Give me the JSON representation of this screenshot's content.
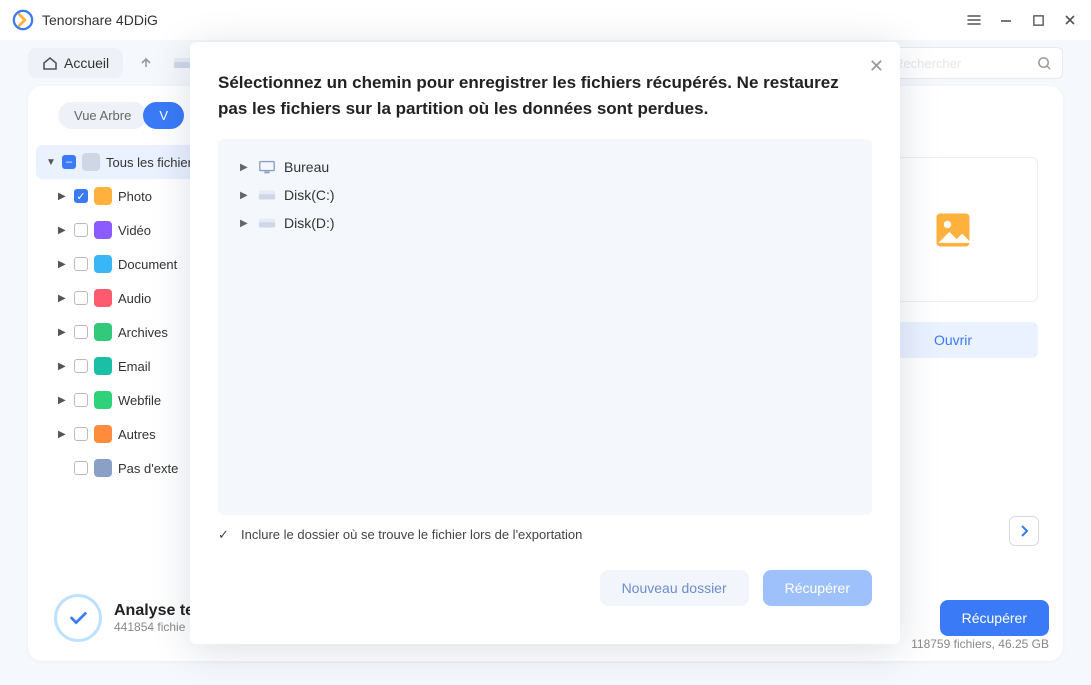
{
  "app": {
    "title": "Tenorshare 4DDiG"
  },
  "toolbar": {
    "home": "Accueil",
    "search_placeholder": "Rechercher"
  },
  "tabs": {
    "tree": "Vue Arbre",
    "active_prefix": "V"
  },
  "sidebar": {
    "root": "Tous les fichiers",
    "items": [
      {
        "label": "Photo",
        "color": "fi-orange",
        "checked": true
      },
      {
        "label": "Vidéo",
        "color": "fi-purple",
        "checked": false
      },
      {
        "label": "Document",
        "color": "fi-cyan",
        "checked": false
      },
      {
        "label": "Audio",
        "color": "fi-red",
        "checked": false
      },
      {
        "label": "Archives",
        "color": "fi-green",
        "checked": false
      },
      {
        "label": "Email",
        "color": "fi-teal",
        "checked": false
      },
      {
        "label": "Webfile",
        "color": "fi-green2",
        "checked": false
      },
      {
        "label": "Autres",
        "color": "fi-orange2",
        "checked": false
      },
      {
        "label": "Pas d'exte",
        "color": "fi-gray",
        "checked": false,
        "nocaret": true
      }
    ]
  },
  "right": {
    "open": "Ouvrir"
  },
  "footer": {
    "title": "Analyse te",
    "subtitle": "441854 fichie",
    "recover": "Récupérer",
    "stats": "118759 fichiers, 46.25 GB"
  },
  "modal": {
    "heading": "Sélectionnez un chemin pour enregistrer les fichiers récupérés. Ne restaurez pas les fichiers sur la partition où les données sont perdues.",
    "destinations": [
      {
        "label": "Bureau",
        "type": "desktop"
      },
      {
        "label": "Disk(C:)",
        "type": "disk"
      },
      {
        "label": "Disk(D:)",
        "type": "disk"
      }
    ],
    "include_folder": "Inclure le dossier où se trouve le fichier lors de l'exportation",
    "new_folder": "Nouveau dossier",
    "recover": "Récupérer"
  }
}
